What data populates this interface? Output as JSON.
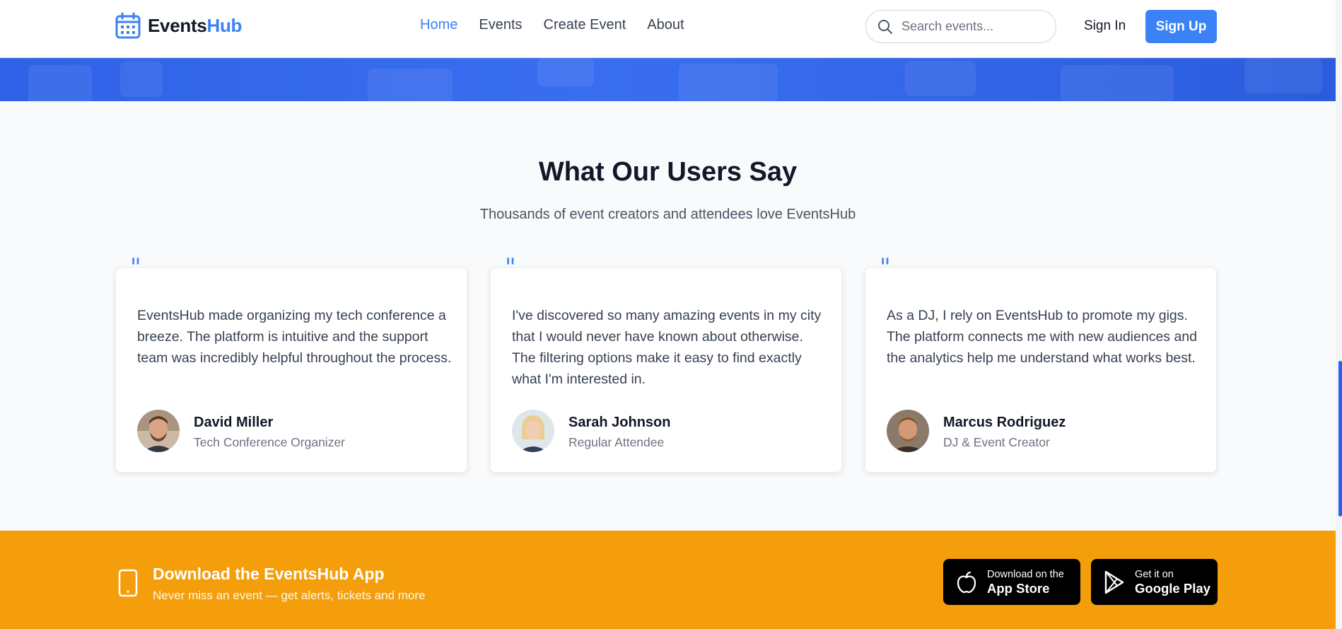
{
  "header": {
    "logo_main": "Events",
    "logo_accent": "Hub",
    "nav": [
      "Home",
      "Events",
      "Create Event",
      "About"
    ],
    "search_placeholder": "Search events...",
    "signin_label": "Sign In",
    "signup_label": "Sign Up",
    "brand_color": "#3b82f6"
  },
  "testimonials": {
    "title": "What Our Users Say",
    "subtitle": "Thousands of event creators and attendees love EventsHub",
    "quote_glyph": "\"",
    "items": [
      {
        "text": "EventsHub made organizing my tech conference a breeze. The platform is intuitive and the support team was incredibly helpful throughout the process.",
        "name": "David Miller",
        "role": "Tech Conference Organizer"
      },
      {
        "text": "I've discovered so many amazing events in my city that I would never have known about otherwise. The filtering options make it easy to find exactly what I'm interested in.",
        "name": "Sarah Johnson",
        "role": "Regular Attendee"
      },
      {
        "text": "As a DJ, I rely on EventsHub to promote my gigs. The platform connects me with new audiences and the analytics help me understand what works best.",
        "name": "Marcus Rodriguez",
        "role": "DJ & Event Creator"
      }
    ]
  },
  "app_banner": {
    "title": "Download the EventsHub App",
    "subtitle": "Never miss an event — get alerts, tickets and more",
    "app_store_small": "Download on the",
    "app_store_big": "App Store",
    "google_play_small": "Get it on",
    "google_play_big": "Google Play",
    "color": "#f59e0b"
  }
}
